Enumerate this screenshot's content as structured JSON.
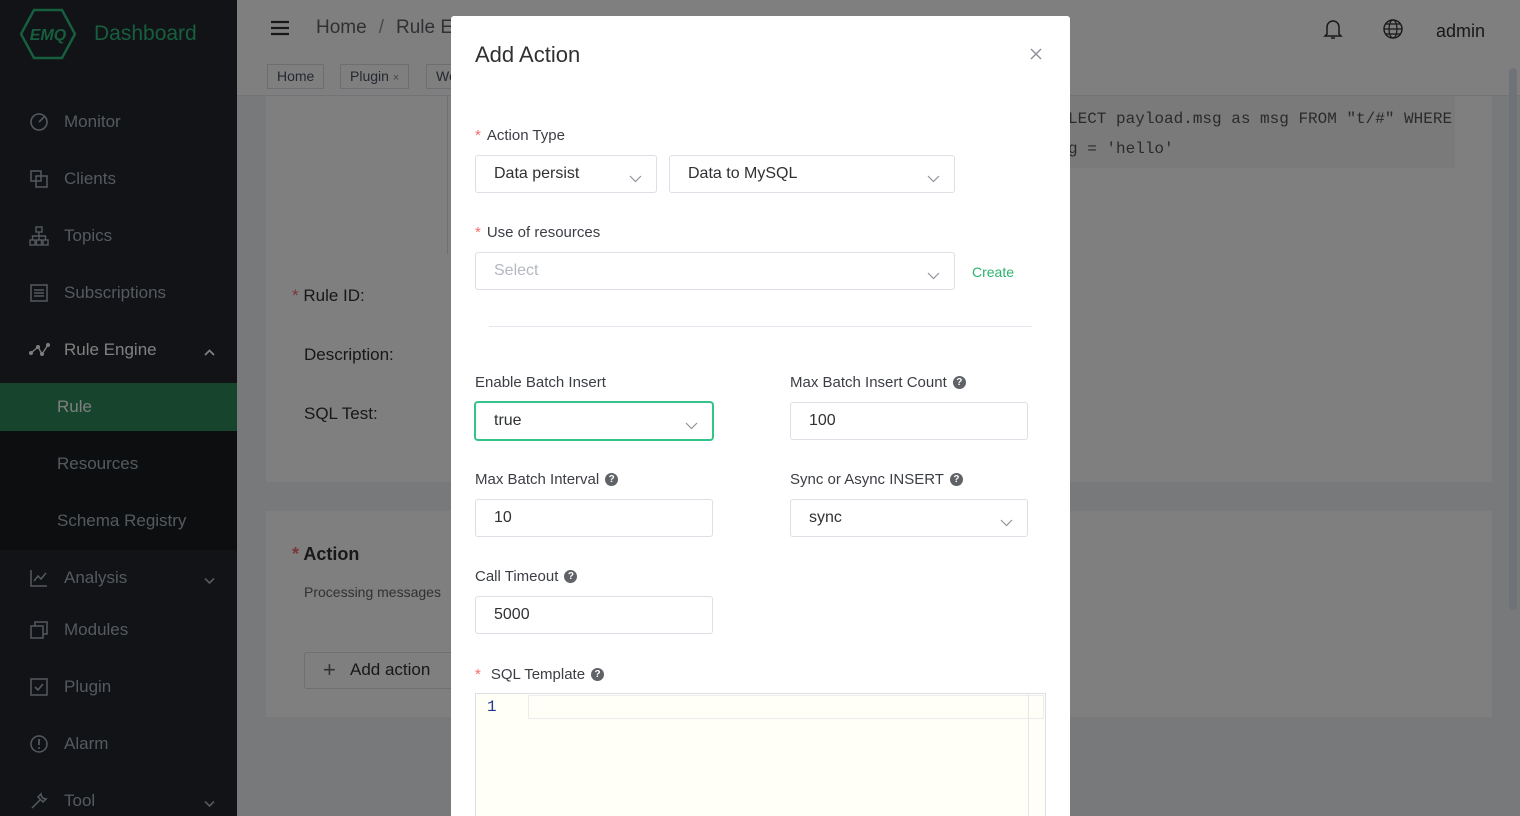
{
  "app": {
    "logo_text": "EMQ",
    "title": "Dashboard",
    "user": "admin",
    "brand_color": "#2fbc7e",
    "sidebar_bg": "#22272c"
  },
  "breadcrumb": {
    "items": [
      "Home",
      "Rule E"
    ]
  },
  "tags": [
    {
      "label": "Home"
    },
    {
      "label": "Plugin",
      "close": "×"
    },
    {
      "label": "We"
    }
  ],
  "sidebar": {
    "items": [
      {
        "label": "Monitor",
        "icon": "monitor-icon"
      },
      {
        "label": "Clients",
        "icon": "clients-icon"
      },
      {
        "label": "Topics",
        "icon": "topics-icon"
      },
      {
        "label": "Subscriptions",
        "icon": "subscriptions-icon"
      },
      {
        "label": "Rule Engine",
        "icon": "rule-engine-icon",
        "expanded": true
      },
      {
        "label": "Analysis",
        "icon": "analysis-icon"
      },
      {
        "label": "Modules",
        "icon": "modules-icon"
      },
      {
        "label": "Plugin",
        "icon": "plugin-icon"
      },
      {
        "label": "Alarm",
        "icon": "alarm-icon"
      },
      {
        "label": "Tool",
        "icon": "tool-icon"
      }
    ],
    "submenu": [
      {
        "label": "Rule",
        "active": true
      },
      {
        "label": "Resources"
      },
      {
        "label": "Schema Registry"
      }
    ]
  },
  "background_page": {
    "sql_line1": "LECT payload.msg as msg FROM \"t/#\" WHERE",
    "sql_line2": "g = 'hello'",
    "rule_id_label": "Rule ID:",
    "description_label": "Description:",
    "sql_test_label": "SQL Test:",
    "action_title": "Action",
    "action_desc": "Processing messages",
    "add_action_label": "Add action",
    "add_action_plus": "+"
  },
  "dialog": {
    "title": "Add Action",
    "action_type": {
      "label": "Action Type",
      "category": "Data persist",
      "type": "Data to MySQL"
    },
    "resources": {
      "label": "Use of resources",
      "placeholder": "Select",
      "create_label": "Create"
    },
    "enable_batch_insert": {
      "label": "Enable Batch Insert",
      "value": "true"
    },
    "max_batch_insert_count": {
      "label": "Max Batch Insert Count",
      "value": "100"
    },
    "max_batch_interval": {
      "label": "Max Batch Interval",
      "value": "10"
    },
    "sync_async": {
      "label": "Sync or Async INSERT",
      "value": "sync"
    },
    "call_timeout": {
      "label": "Call Timeout",
      "value": "5000"
    },
    "sql_template": {
      "label": "SQL Template",
      "line_number": "1"
    },
    "required_mark": "*",
    "help_glyph": "?"
  }
}
